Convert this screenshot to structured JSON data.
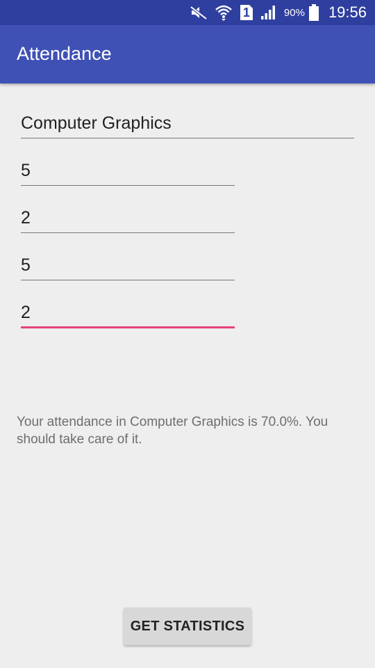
{
  "status_bar": {
    "battery_percent": "90%",
    "time": "19:56",
    "sim_number": "1",
    "icons": [
      "mute-icon",
      "wifi-icon",
      "sim-icon",
      "signal-icon",
      "battery-icon"
    ]
  },
  "app_bar": {
    "title": "Attendance"
  },
  "form": {
    "subject": "Computer Graphics",
    "field_1": "5",
    "field_2": "2",
    "field_3": "5",
    "field_4": "2"
  },
  "result": {
    "message": "Your attendance in Computer Graphics is 70.0%. You should take care of it."
  },
  "actions": {
    "get_statistics_label": "GET STATISTICS"
  },
  "colors": {
    "status_bar": "#2f3f9f",
    "app_bar": "#3f51b5",
    "accent": "#e8407a",
    "background": "#eeeeee"
  }
}
